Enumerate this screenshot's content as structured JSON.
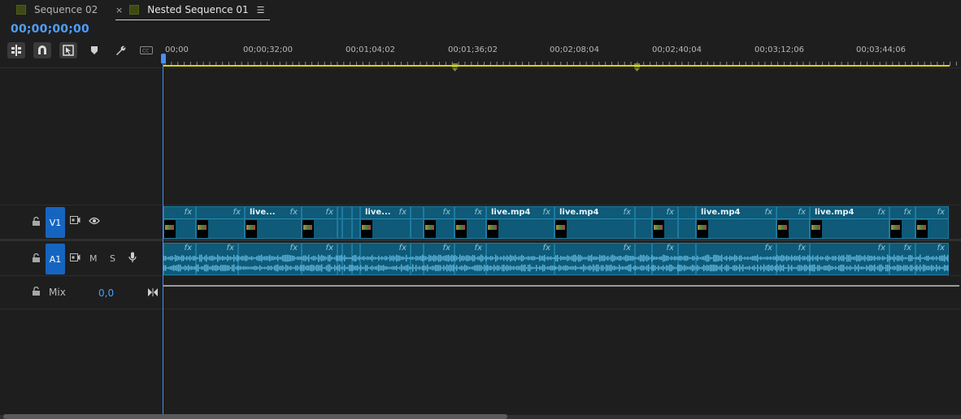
{
  "tabs": [
    {
      "label": "Sequence 02"
    },
    {
      "label": "Nested Sequence 01",
      "close": "×",
      "menu": "☰"
    }
  ],
  "timecode": "00;00;00;00",
  "ruler_labels": [
    "00;00",
    "00;00;32;00",
    "00;01;04;02",
    "00;01;36;02",
    "00;02;08;04",
    "00;02;40;04",
    "00;03;12;06",
    "00;03;44;06"
  ],
  "tracks": {
    "video": {
      "label": "V1"
    },
    "audio": {
      "label": "A1",
      "mute": "M",
      "solo": "S"
    },
    "mix": {
      "label": "Mix",
      "value": "0,0"
    }
  },
  "clip_fx": "fx",
  "clip_names": {
    "c3": "live...",
    "c7": "live...",
    "c11": "live.mp4",
    "c12": "live.mp4",
    "c16": "live.mp4",
    "c18": "live.mp4"
  },
  "colors": {
    "accent": "#4d9fff",
    "clip": "#0e5a78",
    "workarea": "#d8d21a",
    "track_label": "#1565c0"
  }
}
